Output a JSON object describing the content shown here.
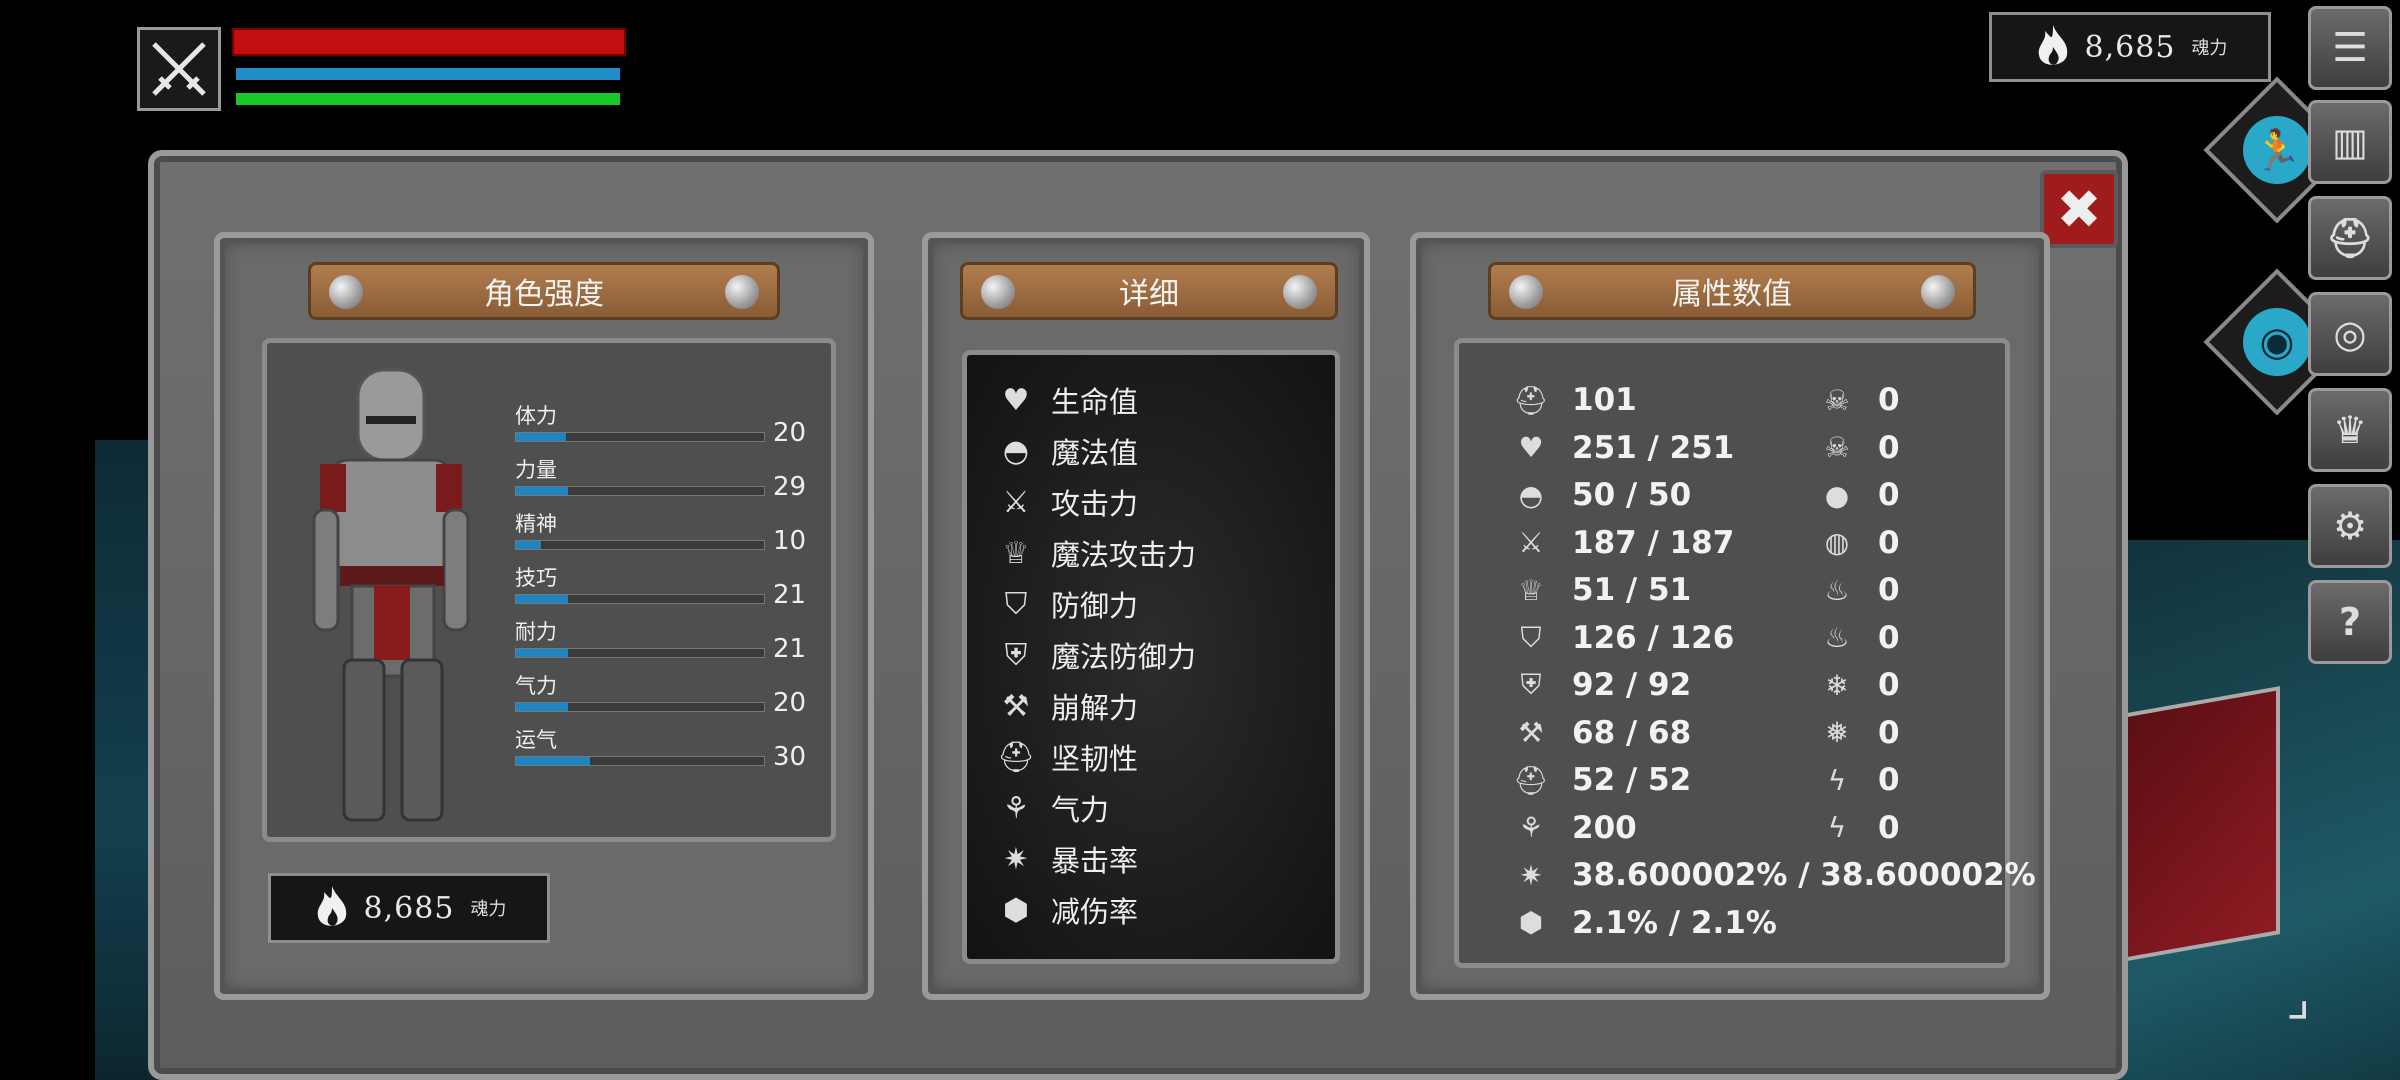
{
  "hud": {
    "weapon_icon": "crossed-swords-icon",
    "colors": {
      "health": "#c21010",
      "mana": "#1e8fc7",
      "stamina": "#18c92a"
    }
  },
  "souls": {
    "amount": "8,685",
    "unit": "魂力"
  },
  "character_panel": {
    "title": "角色强度",
    "stats": [
      {
        "label": "体力",
        "value": "20",
        "fill": 0.2
      },
      {
        "label": "力量",
        "value": "29",
        "fill": 0.21
      },
      {
        "label": "精神",
        "value": "10",
        "fill": 0.1
      },
      {
        "label": "技巧",
        "value": "21",
        "fill": 0.21
      },
      {
        "label": "耐力",
        "value": "21",
        "fill": 0.21
      },
      {
        "label": "气力",
        "value": "20",
        "fill": 0.21
      },
      {
        "label": "运气",
        "value": "30",
        "fill": 0.3
      }
    ]
  },
  "detail_panel": {
    "title": "详细",
    "items": [
      {
        "label": "生命值",
        "icon": "heart-icon"
      },
      {
        "label": "魔法值",
        "icon": "hood-icon"
      },
      {
        "label": "攻击力",
        "icon": "sword-icon"
      },
      {
        "label": "魔法攻击力",
        "icon": "magic-crown-icon"
      },
      {
        "label": "防御力",
        "icon": "shield-icon"
      },
      {
        "label": "魔法防御力",
        "icon": "magic-shield-icon"
      },
      {
        "label": "崩解力",
        "icon": "pickaxe-icon"
      },
      {
        "label": "坚韧性",
        "icon": "helmet-icon"
      },
      {
        "label": "气力",
        "icon": "lungs-icon"
      },
      {
        "label": "暴击率",
        "icon": "critical-star-icon"
      },
      {
        "label": "减伤率",
        "icon": "damage-reduction-icon"
      }
    ]
  },
  "attributes_panel": {
    "title": "属性数值",
    "left_column": [
      {
        "icon": "helmet-icon",
        "value": "101"
      },
      {
        "icon": "heart-icon",
        "value": "251 / 251"
      },
      {
        "icon": "hood-icon",
        "value": "50 / 50"
      },
      {
        "icon": "sword-icon",
        "value": "187 / 187"
      },
      {
        "icon": "magic-crown-icon",
        "value": "51 / 51"
      },
      {
        "icon": "shield-icon",
        "value": "126 / 126"
      },
      {
        "icon": "magic-shield-icon",
        "value": "92 / 92"
      },
      {
        "icon": "pickaxe-icon",
        "value": "68 / 68"
      },
      {
        "icon": "knight-helmet-icon",
        "value": "52 / 52"
      },
      {
        "icon": "lungs-icon",
        "value": "200"
      },
      {
        "icon": "critical-star-icon",
        "value": "38.600002% / 38.600002%"
      },
      {
        "icon": "damage-reduction-icon",
        "value": "2.1% / 2.1%"
      }
    ],
    "right_column": [
      {
        "icon": "skull-icon",
        "value": "0"
      },
      {
        "icon": "skull-resist-icon",
        "value": "0"
      },
      {
        "icon": "drop-icon",
        "value": "0"
      },
      {
        "icon": "drop-resist-icon",
        "value": "0"
      },
      {
        "icon": "fire-icon",
        "value": "0"
      },
      {
        "icon": "fire-resist-icon",
        "value": "0"
      },
      {
        "icon": "frost-icon",
        "value": "0"
      },
      {
        "icon": "frost-resist-icon",
        "value": "0"
      },
      {
        "icon": "lightning-icon",
        "value": "0"
      },
      {
        "icon": "lightning-resist-icon",
        "value": "0"
      }
    ]
  },
  "side_menu": {
    "buttons": [
      "menu-icon",
      "inventory-icon",
      "helmet-icon",
      "rune-icon",
      "crown-icon",
      "gear-icon",
      "help-icon"
    ],
    "help_glyph": "?"
  }
}
